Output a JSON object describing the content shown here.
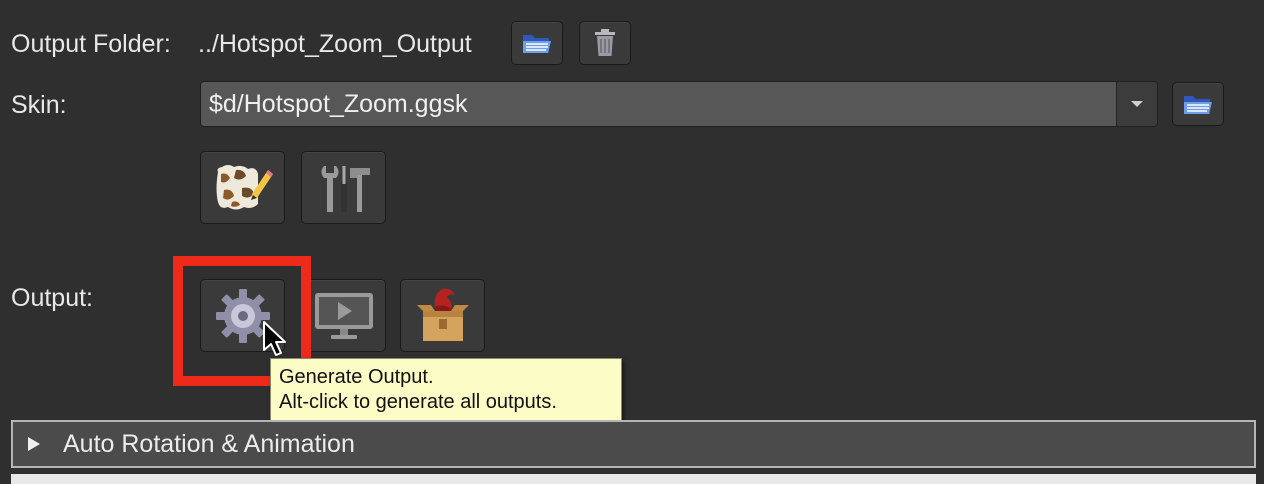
{
  "output_folder": {
    "label": "Output Folder:",
    "path": "../Hotspot_Zoom_Output",
    "open_icon": "folder-open-icon",
    "delete_icon": "trash-icon"
  },
  "skin": {
    "label": "Skin:",
    "value": "$d/Hotspot_Zoom.ggsk",
    "open_icon": "folder-open-icon",
    "edit_icon": "skin-editor-icon",
    "tools_icon": "tools-icon"
  },
  "output": {
    "label": "Output:",
    "generate_icon": "gear-icon",
    "preview_icon": "monitor-play-icon",
    "package_icon": "package-icon"
  },
  "tooltip": {
    "line1": "Generate Output.",
    "line2": "Alt-click to generate all outputs."
  },
  "section": {
    "title": "Auto Rotation & Animation",
    "expand_icon": "triangle-right-icon"
  },
  "colors": {
    "background": "#2f2f2f",
    "highlight": "#ee2a1b",
    "tooltip_bg": "#fcfcc7"
  }
}
